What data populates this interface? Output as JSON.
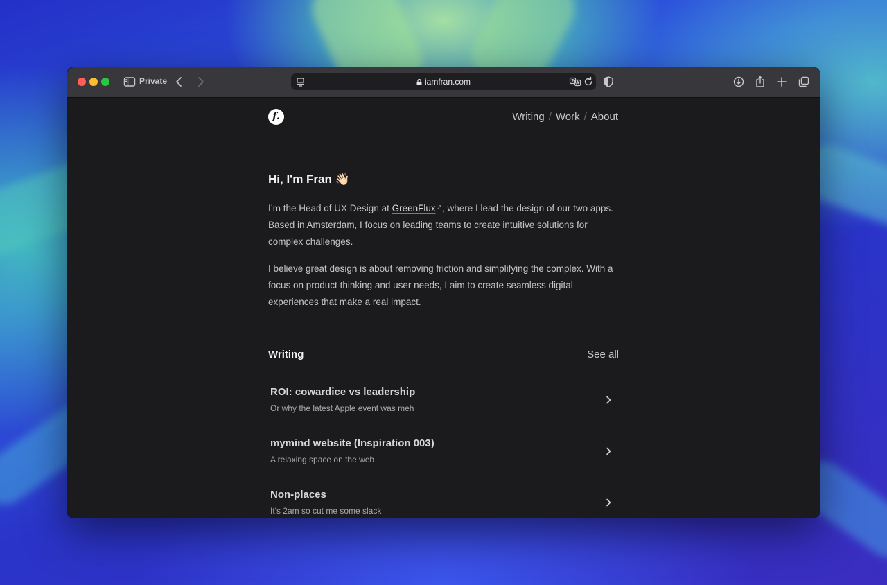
{
  "browser": {
    "private_label": "Private",
    "url": "iamfran.com"
  },
  "site": {
    "logo_letter": "f.",
    "nav": [
      "Writing",
      "Work",
      "About"
    ],
    "nav_separator": "/",
    "greeting": "Hi, I'm Fran 👋🏻",
    "intro": {
      "part1": "I’m the Head of UX Design at ",
      "company_link": "GreenFlux",
      "external_arrow": "↗",
      "part2": ", where I lead the design of our two apps. Based in Amsterdam, I focus on leading teams to create intuitive solutions for complex challenges."
    },
    "paragraph2": "I believe great design is about removing friction and simplifying the complex. With a focus on product thinking and user needs, I aim to create seamless digital experiences that make a real impact.",
    "writing_section": {
      "title": "Writing",
      "see_all": "See all",
      "posts": [
        {
          "title": "ROI: cowardice vs leadership",
          "subtitle": "Or why the latest Apple event was meh"
        },
        {
          "title": "mymind website (Inspiration 003)",
          "subtitle": "A relaxing space on the web"
        },
        {
          "title": "Non-places",
          "subtitle": "It's 2am so cut me some slack"
        }
      ]
    }
  },
  "colors": {
    "page_background": "#1b1b1d",
    "toolbar": "#38383c",
    "text_primary": "#f2f2f4",
    "text_body": "#c4c4c8"
  }
}
